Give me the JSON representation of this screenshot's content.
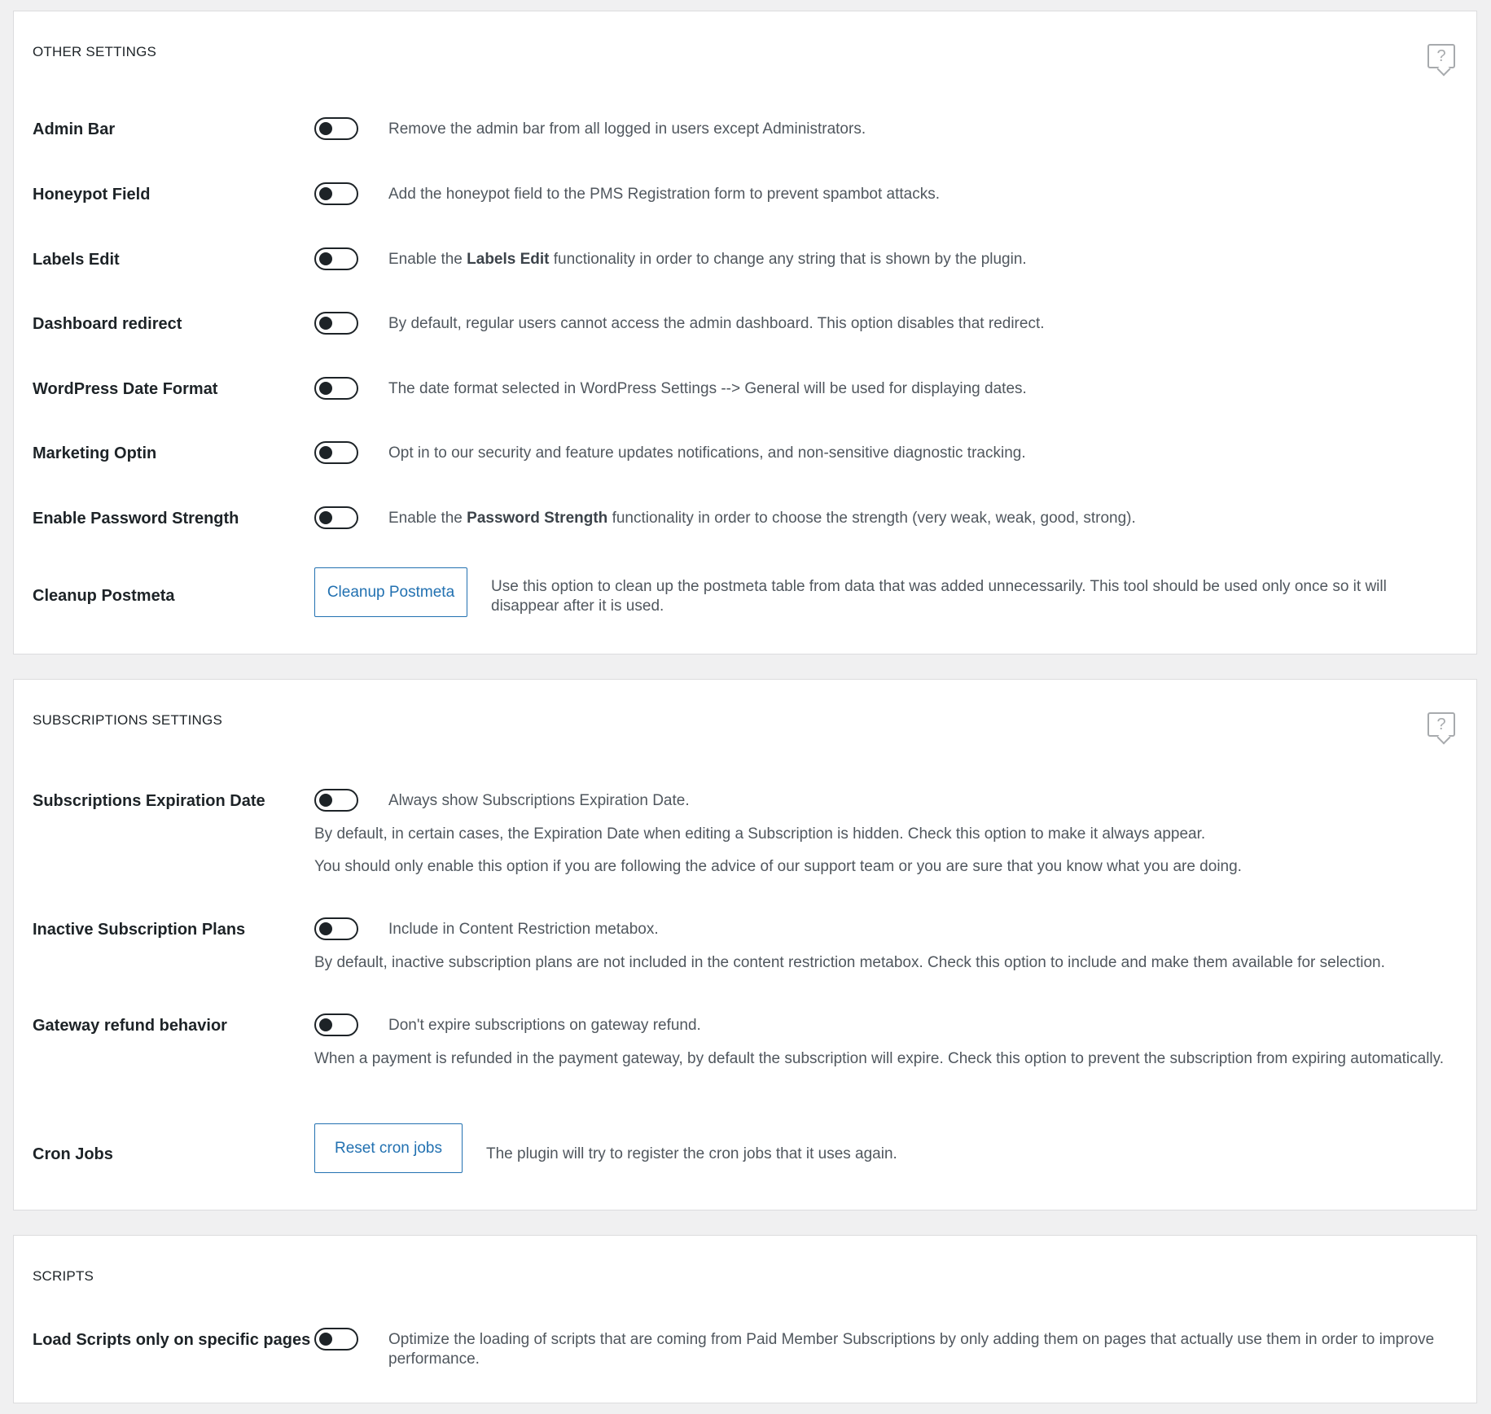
{
  "other": {
    "title": "OTHER SETTINGS",
    "help_icon": "?",
    "rows": [
      {
        "label": "Admin Bar",
        "desc": "Remove the admin bar from all logged in users except Administrators."
      },
      {
        "label": "Honeypot Field",
        "desc": "Add the honeypot field to the PMS Registration form to prevent spambot attacks."
      },
      {
        "label": "Labels Edit",
        "desc_pre": "Enable the ",
        "desc_bold": "Labels Edit",
        "desc_post": " functionality in order to change any string that is shown by the plugin."
      },
      {
        "label": "Dashboard redirect",
        "desc": "By default, regular users cannot access the admin dashboard. This option disables that redirect."
      },
      {
        "label": "WordPress Date Format",
        "desc": "The date format selected in WordPress Settings --> General will be used for displaying dates."
      },
      {
        "label": "Marketing Optin",
        "desc": "Opt in to our security and feature updates notifications, and non-sensitive diagnostic tracking."
      },
      {
        "label": "Enable Password Strength",
        "desc_pre": "Enable the ",
        "desc_bold": "Password Strength",
        "desc_post": " functionality in order to choose the strength (very weak, weak, good, strong)."
      }
    ],
    "cleanup": {
      "label": "Cleanup Postmeta",
      "button": "Cleanup Postmeta",
      "desc": "Use this option to clean up the postmeta table from data that was added unnecessarily. This tool should be used only once so it will disappear after it is used."
    }
  },
  "subscriptions": {
    "title": "SUBSCRIPTIONS SETTINGS",
    "help_icon": "?",
    "expiration": {
      "label": "Subscriptions Expiration Date",
      "desc": "Always show Subscriptions Expiration Date.",
      "note1": "By default, in certain cases, the Expiration Date when editing a Subscription is hidden. Check this option to make it always appear.",
      "note2": "You should only enable this option if you are following the advice of our support team or you are sure that you know what you are doing."
    },
    "inactive": {
      "label": "Inactive Subscription Plans",
      "desc": "Include in Content Restriction metabox.",
      "note": "By default, inactive subscription plans are not included in the content restriction metabox. Check this option to include and make them available for selection."
    },
    "refund": {
      "label": "Gateway refund behavior",
      "desc": "Don't expire subscriptions on gateway refund.",
      "note": "When a payment is refunded in the payment gateway, by default the subscription will expire. Check this option to prevent the subscription from expiring automatically."
    },
    "cron": {
      "label": "Cron Jobs",
      "button": "Reset cron jobs",
      "desc": "The plugin will try to register the cron jobs that it uses again."
    }
  },
  "scripts": {
    "title": "SCRIPTS",
    "row": {
      "label": "Load Scripts only on specific pages",
      "desc": "Optimize the loading of scripts that are coming from Paid Member Subscriptions by only adding them on pages that actually use them in order to improve performance."
    }
  }
}
